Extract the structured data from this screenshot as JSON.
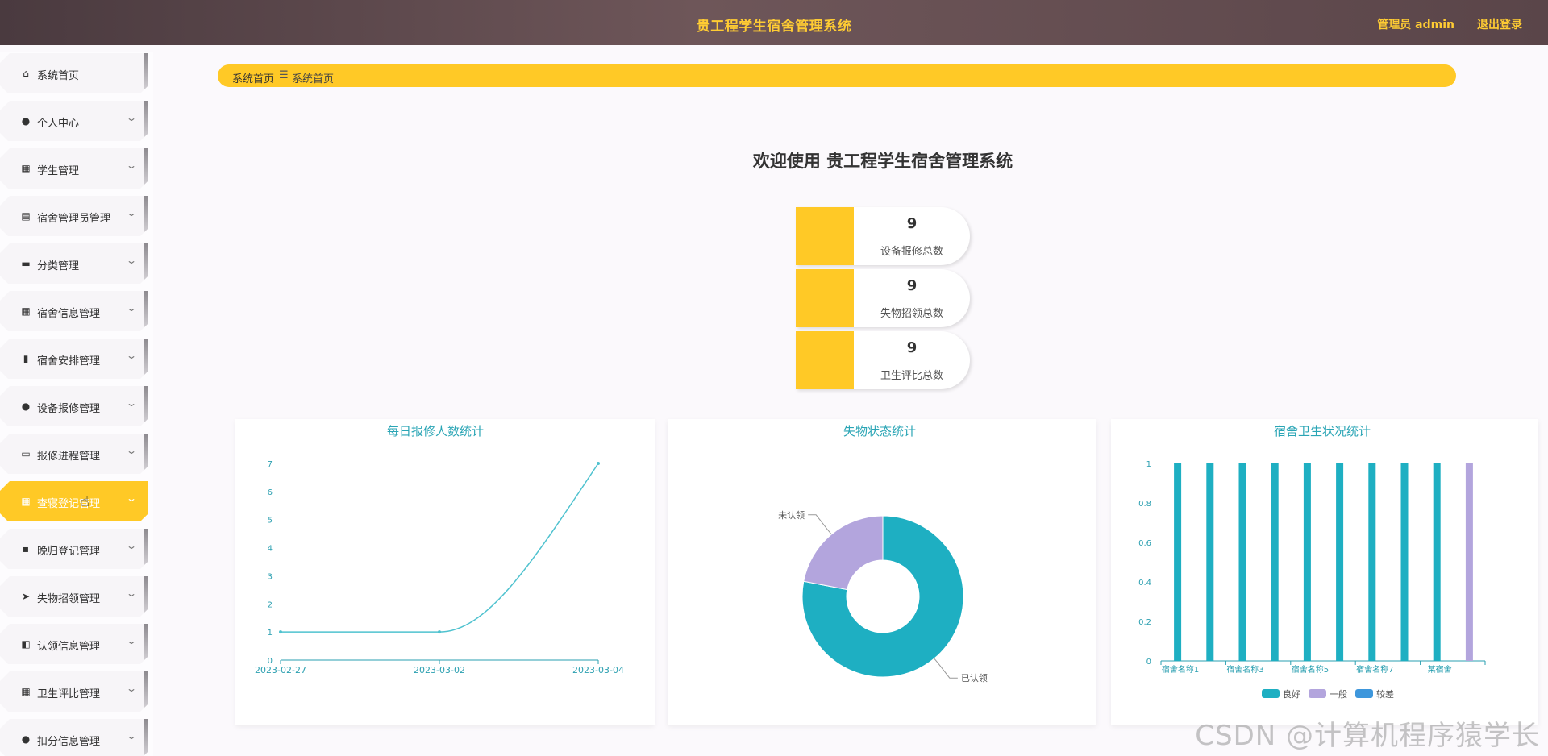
{
  "header": {
    "title": "贵工程学生宿舍管理系统",
    "user_label": "管理员 admin",
    "logout_label": "退出登录"
  },
  "sidebar": {
    "items": [
      {
        "label": "系统首页",
        "icon": "home-icon",
        "has_submenu": false
      },
      {
        "label": "个人中心",
        "icon": "user-icon",
        "has_submenu": true
      },
      {
        "label": "学生管理",
        "icon": "grid-icon",
        "has_submenu": true
      },
      {
        "label": "宿舍管理员管理",
        "icon": "clipboard-icon",
        "has_submenu": true
      },
      {
        "label": "分类管理",
        "icon": "briefcase-icon",
        "has_submenu": true
      },
      {
        "label": "宿舍信息管理",
        "icon": "grid-icon",
        "has_submenu": true
      },
      {
        "label": "宿舍安排管理",
        "icon": "bar-chart-icon",
        "has_submenu": true
      },
      {
        "label": "设备报修管理",
        "icon": "user-icon",
        "has_submenu": true
      },
      {
        "label": "报修进程管理",
        "icon": "printer-icon",
        "has_submenu": true
      },
      {
        "label": "查寝登记管理",
        "icon": "grid-icon",
        "has_submenu": true,
        "active": true
      },
      {
        "label": "晚归登记管理",
        "icon": "message-icon",
        "has_submenu": true
      },
      {
        "label": "失物招领管理",
        "icon": "send-icon",
        "has_submenu": true
      },
      {
        "label": "认领信息管理",
        "icon": "wallet-icon",
        "has_submenu": true
      },
      {
        "label": "卫生评比管理",
        "icon": "grid-icon",
        "has_submenu": true
      },
      {
        "label": "扣分信息管理",
        "icon": "user-icon",
        "has_submenu": true
      }
    ],
    "active_label_visible": "查寝登记"
  },
  "breadcrumb": {
    "home": "系统首页",
    "separator": "☰",
    "current": "系统首页"
  },
  "welcome": "欢迎使用 贵工程学生宿舍管理系统",
  "stats": [
    {
      "value": "9",
      "label": "设备报修总数"
    },
    {
      "value": "9",
      "label": "失物招领总数"
    },
    {
      "value": "9",
      "label": "卫生评比总数"
    }
  ],
  "chart_data": [
    {
      "type": "line",
      "title": "每日报修人数统计",
      "x": [
        "2023-02-27",
        "2023-03-02",
        "2023-03-04"
      ],
      "values": [
        1,
        1,
        7
      ],
      "ylim": [
        0,
        7
      ],
      "yticks": [
        "0",
        "1",
        "2",
        "3",
        "4",
        "5",
        "6",
        "7"
      ],
      "smooth": true,
      "color": "#4fc2cf"
    },
    {
      "type": "pie",
      "title": "失物状态统计",
      "donut": true,
      "slices": [
        {
          "label": "已认领",
          "value": 78,
          "color": "#1eafc2"
        },
        {
          "label": "未认领",
          "value": 22,
          "color": "#b3a5dd"
        }
      ]
    },
    {
      "type": "bar",
      "title": "宿舍卫生状况统计",
      "xtick_labels": [
        "宿舍名称1",
        "宿舍名称3",
        "宿舍名称5",
        "宿舍名称7",
        "某宿舍"
      ],
      "categories_count": 10,
      "series": [
        {
          "name": "良好",
          "color": "#1eafc2",
          "values": [
            1,
            1,
            1,
            1,
            1,
            1,
            1,
            1,
            1,
            0
          ]
        },
        {
          "name": "一般",
          "color": "#b3a5dd",
          "values": [
            0,
            0,
            0,
            0,
            0,
            0,
            0,
            0,
            0,
            1
          ]
        },
        {
          "name": "较差",
          "color": "#3e97dc",
          "values": [
            0,
            0,
            0,
            0,
            0,
            0,
            0,
            0,
            0,
            0
          ]
        }
      ],
      "ylim": [
        0,
        1
      ],
      "yticks": [
        "0",
        "0.2",
        "0.4",
        "0.6",
        "0.8",
        "1"
      ],
      "legend": "bottom"
    }
  ],
  "watermark": "CSDN @计算机程序猿学长"
}
